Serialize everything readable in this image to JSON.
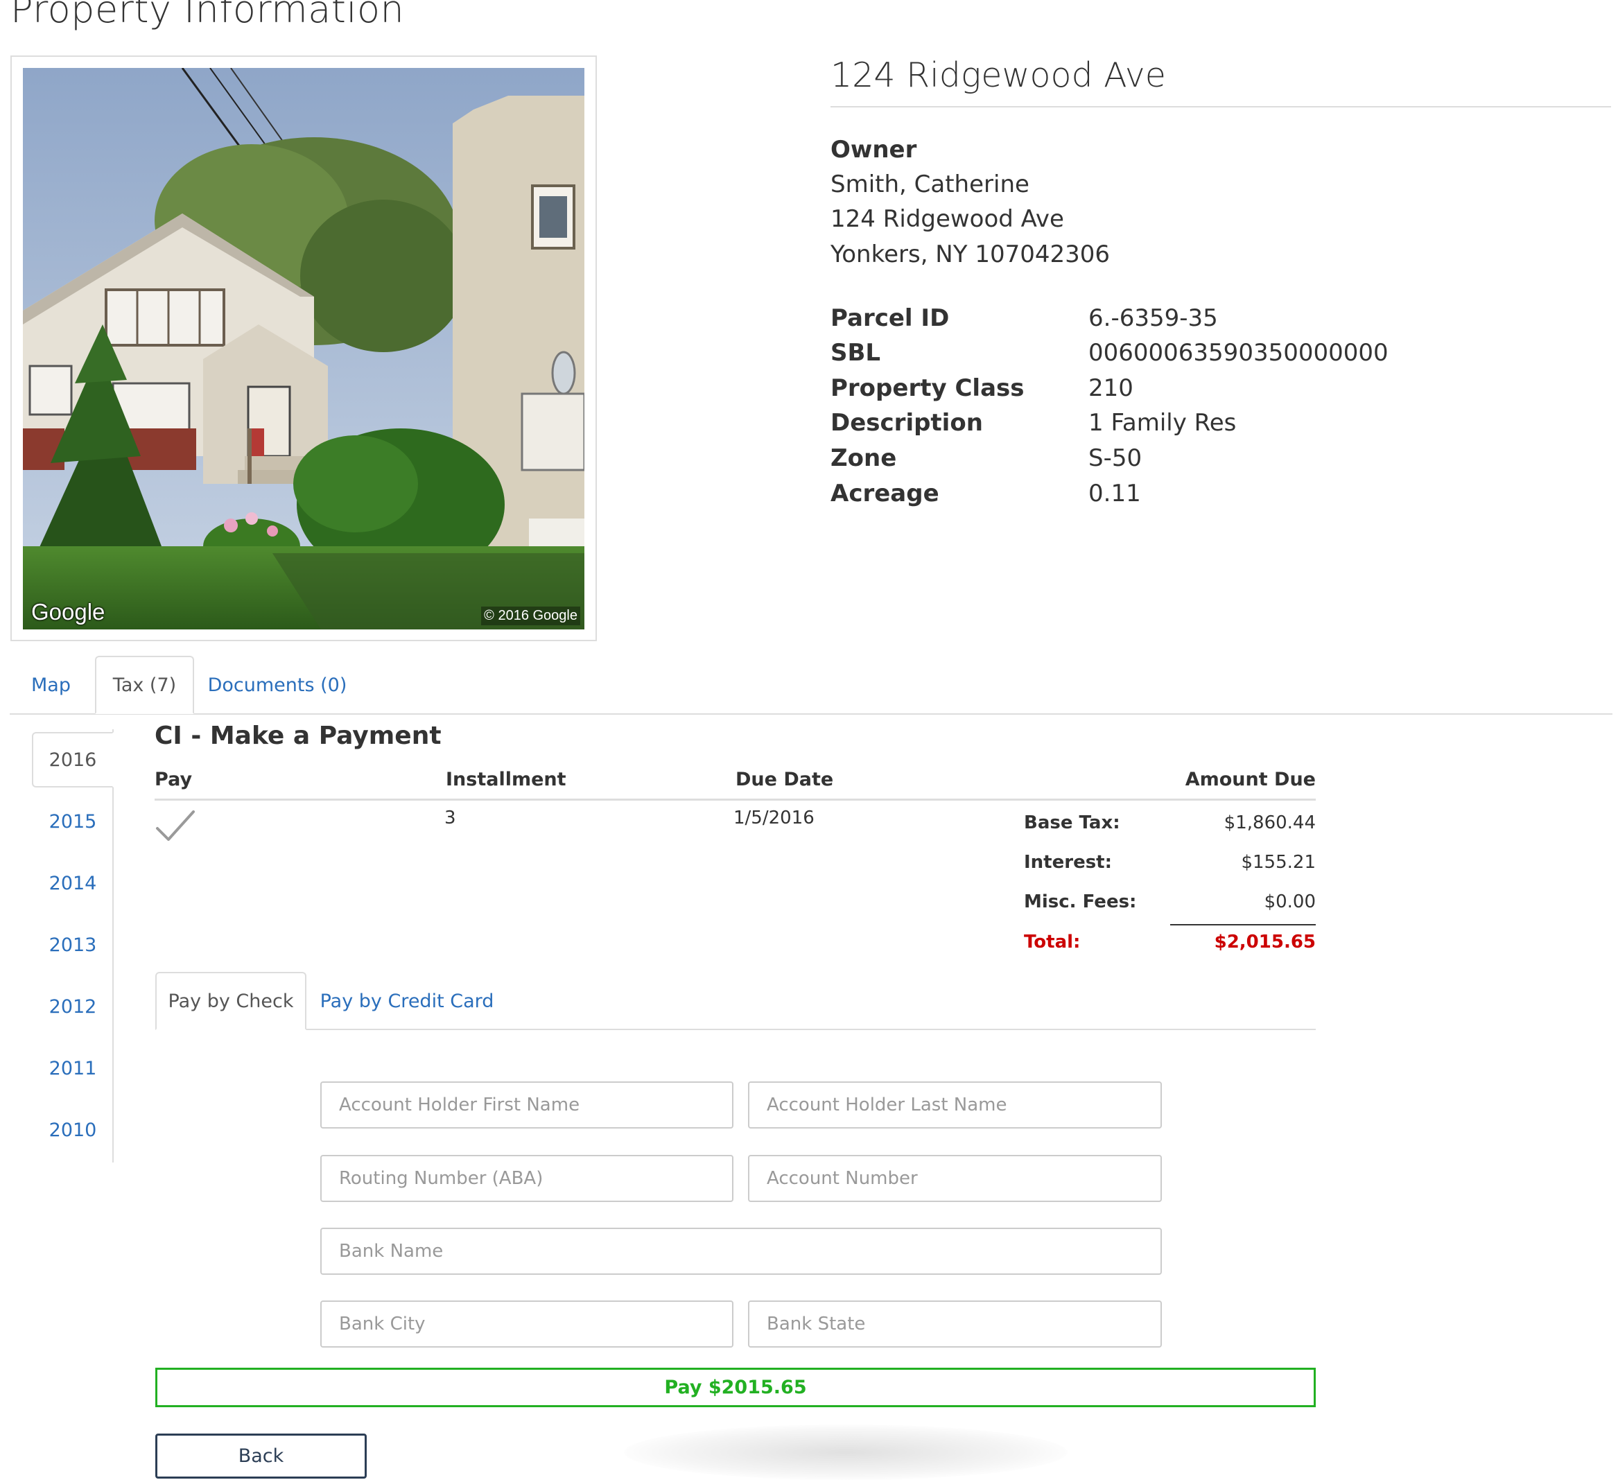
{
  "page": {
    "title": "Property Information"
  },
  "photo": {
    "alt": "Street view of 124 Ridgewood Ave",
    "brand": "Google",
    "copyright": "© 2016 Google"
  },
  "property": {
    "address": "124 Ridgewood Ave",
    "owner_label": "Owner",
    "owner_name": "Smith, Catherine",
    "owner_street": "124 Ridgewood Ave",
    "owner_city_line": "Yonkers, NY 107042306",
    "details": [
      {
        "label": "Parcel ID",
        "value": "6.-6359-35"
      },
      {
        "label": "SBL",
        "value": "00600063590350000000"
      },
      {
        "label": "Property Class",
        "value": "210"
      },
      {
        "label": "Description",
        "value": "1 Family Res"
      },
      {
        "label": "Zone",
        "value": "S-50"
      },
      {
        "label": "Acreage",
        "value": "0.11"
      }
    ]
  },
  "tabs": [
    {
      "label": "Map",
      "active": false
    },
    {
      "label": "Tax (7)",
      "active": true
    },
    {
      "label": "Documents (0)",
      "active": false
    }
  ],
  "years": [
    {
      "label": "2016",
      "active": true
    },
    {
      "label": "2015",
      "active": false
    },
    {
      "label": "2014",
      "active": false
    },
    {
      "label": "2013",
      "active": false
    },
    {
      "label": "2012",
      "active": false
    },
    {
      "label": "2011",
      "active": false
    },
    {
      "label": "2010",
      "active": false
    }
  ],
  "payment": {
    "title": "CI - Make a Payment",
    "columns": {
      "pay": "Pay",
      "installment": "Installment",
      "due_date": "Due Date",
      "amount_due": "Amount Due"
    },
    "row": {
      "selected": true,
      "installment": "3",
      "due_date": "1/5/2016",
      "amounts": [
        {
          "label": "Base Tax:",
          "value": "$1,860.44"
        },
        {
          "label": "Interest:",
          "value": "$155.21"
        },
        {
          "label": "Misc. Fees:",
          "value": "$0.00"
        }
      ],
      "total_label": "Total:",
      "total_value": "$2,015.65"
    }
  },
  "pay_tabs": [
    {
      "label": "Pay by Check",
      "active": true
    },
    {
      "label": "Pay by Credit Card",
      "active": false
    }
  ],
  "form": {
    "first_name": {
      "placeholder": "Account Holder First Name",
      "value": ""
    },
    "last_name": {
      "placeholder": "Account Holder Last Name",
      "value": ""
    },
    "routing": {
      "placeholder": "Routing Number (ABA)",
      "value": ""
    },
    "account": {
      "placeholder": "Account Number",
      "value": ""
    },
    "bank_name": {
      "placeholder": "Bank Name",
      "value": ""
    },
    "bank_city": {
      "placeholder": "Bank City",
      "value": ""
    },
    "bank_state": {
      "placeholder": "Bank State",
      "value": ""
    }
  },
  "buttons": {
    "pay": "Pay $2015.65",
    "back": "Back"
  },
  "colors": {
    "link": "#2a6ebb",
    "total": "#cc0000",
    "pay_button": "#22b022",
    "back_button": "#2c3e55",
    "border": "#dddddd"
  }
}
